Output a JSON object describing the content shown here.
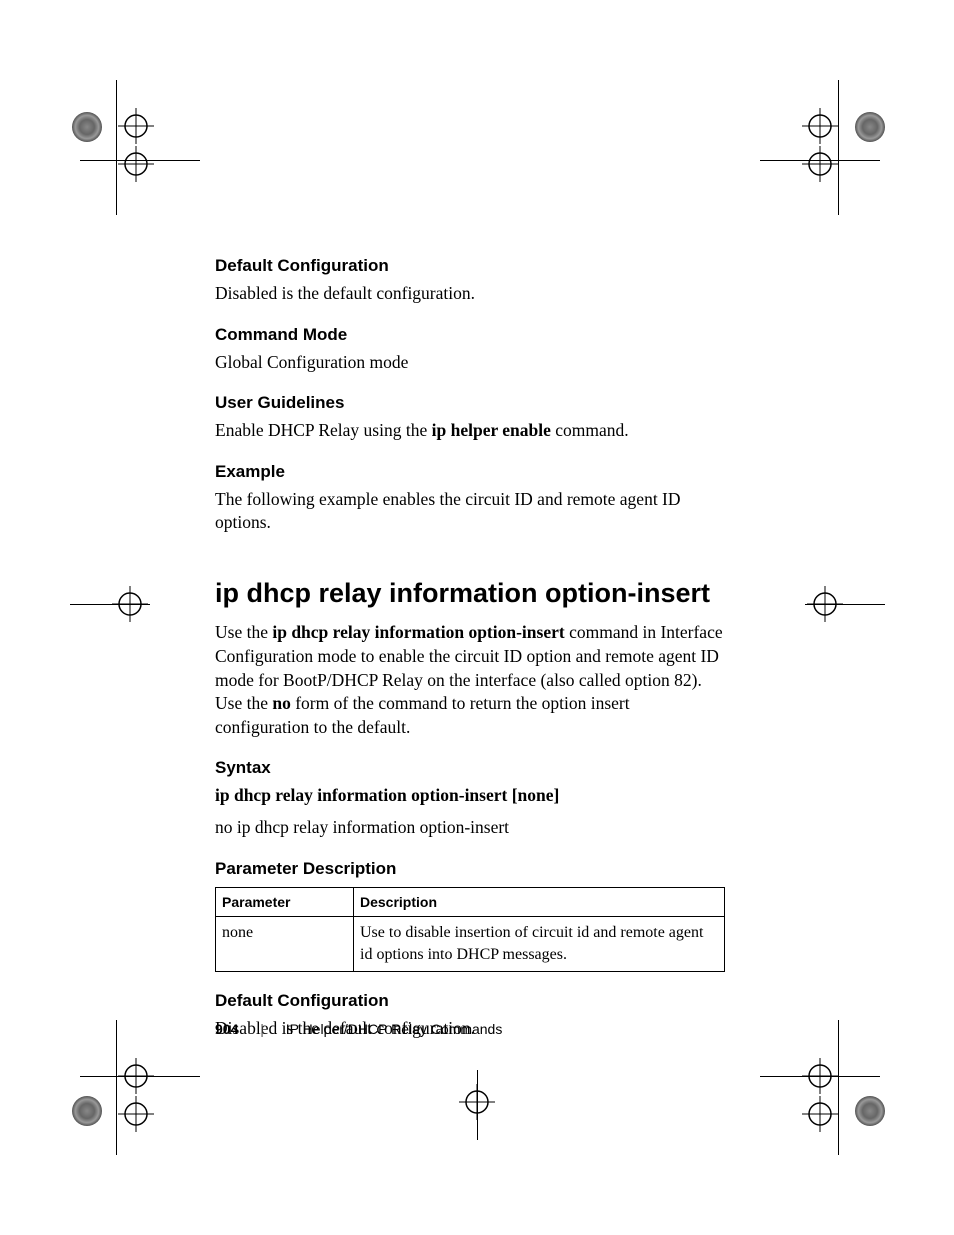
{
  "sections": {
    "defcfg1": {
      "h": "Default Configuration",
      "p": "Disabled is the default configuration."
    },
    "cmdmode": {
      "h": "Command Mode",
      "p": "Global Configuration mode"
    },
    "userguide": {
      "h": "User Guidelines",
      "p_pre": "Enable DHCP Relay using the ",
      "bold": "ip helper enable",
      "p_post": " command."
    },
    "example": {
      "h": "Example",
      "p": "The following example enables the circuit ID and remote agent ID options."
    },
    "title": "ip dhcp relay information option-insert",
    "intro": {
      "pre": "Use the ",
      "b1": "ip dhcp relay information option-insert",
      "mid": " command in Interface Configuration mode to enable the circuit ID option and remote agent ID mode for BootP/DHCP Relay on the interface (also called option 82). Use the ",
      "b2": "no",
      "post": " form of the command to return the option insert configuration to the default."
    },
    "syntax": {
      "h": "Syntax",
      "l1_b": "ip dhcp relay information option-insert [none]",
      "l2": "no ip dhcp relay information option-insert"
    },
    "paramdesc": {
      "h": "Parameter Description",
      "th1": "Parameter",
      "th2": "Description",
      "r1c1": "none",
      "r1c2": "Use to disable insertion of circuit id and remote agent id options into DHCP messages."
    },
    "defcfg2": {
      "h": "Default Configuration",
      "p": "Disabled is the default configuration."
    }
  },
  "footer": {
    "page": "904",
    "chapter": "IP Helper/DHCP Relay Commands"
  }
}
